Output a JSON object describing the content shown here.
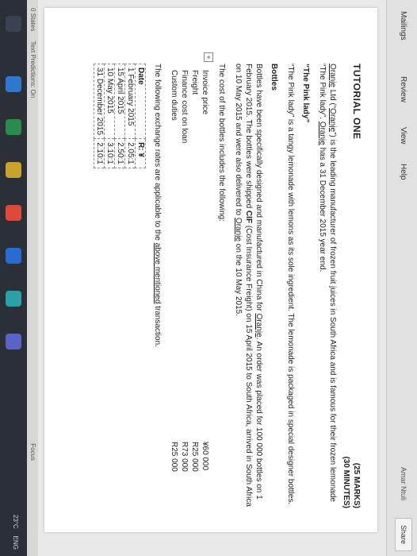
{
  "ribbon": {
    "tabs": [
      "Mailings",
      "Review",
      "View",
      "Help"
    ],
    "right_text": "Amar Ntuli",
    "share_label": "Share"
  },
  "doc": {
    "title": "TUTORIAL ONE",
    "marks": "(25 MARKS)",
    "minutes": "(30 MINUTES)",
    "intro": {
      "company": "Oranje",
      "p1": " Ltd (“",
      "company2": "Oranje",
      "p2": "”) is the leading manufacturer of frozen fruit juices in South Africa and is famous for their frozen lemonade “The Pink lady”. ",
      "company3": "Oranje",
      "p3": " has a 31 December 2015 year end."
    },
    "product_heading": "“The Pink lady”",
    "product_desc": "“The Pink lady” is a tangy lemonade with lemons as its sole ingredient. The lemonade is packaged in special designer bottles.",
    "bottles_heading": "Bottles",
    "bottles_para": {
      "p1": "Bottles have been specifically designed and manufactured in China for ",
      "company": "Oranje",
      "p2": ". An order was placed for 100 000 bottles on 1 February 2015. The bottles were shipped ",
      "cif": "CIF",
      "p3": " (Cost Insurance Freight) on 15 April 2015 to South Africa, arrived in South Africa on 10 May 2015 and were also delivered to ",
      "company2": "Oranje",
      "p4": " on the 10 May 2015."
    },
    "cost_intro": "The cost of the bottles includes the following:",
    "costs": [
      {
        "label": "Invoice price",
        "value": "¥60 000"
      },
      {
        "label": "Freight",
        "value": "R25 000"
      },
      {
        "label": "Finance cost on loan",
        "value": "R73 000"
      },
      {
        "label": "Custom duties",
        "value": "R25 000"
      }
    ],
    "rates_intro": {
      "p1": "The following exchange rates are applicable to the ",
      "link": "above mentioned",
      "p2": " transaction."
    },
    "rates_headers": [
      "Date",
      "R: ¥"
    ],
    "rates_rows": [
      [
        "1 February 2015",
        "2.05:1"
      ],
      [
        "15 April 2015",
        "2.50:1"
      ],
      [
        "10 May 2015",
        "3.10:1"
      ],
      [
        "31 December 2015",
        "2.10:1"
      ]
    ]
  },
  "status": {
    "left": "0 States",
    "predictions": "Text Predictions: On",
    "focus": "Focus"
  },
  "taskbar": {
    "temp": "23°C",
    "lang": "ENG"
  },
  "colors": {
    "taskbar": "#2b2f36",
    "page": "#ffffff"
  }
}
